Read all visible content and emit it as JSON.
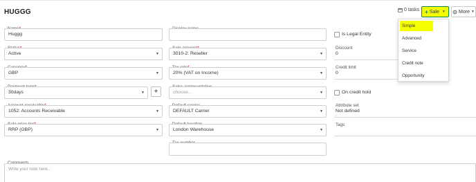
{
  "page": {
    "title": "HUGGG"
  },
  "header": {
    "tasks_label": "0 tasks",
    "sale_button": "Sale",
    "more_button": "More"
  },
  "sale_menu": {
    "items": [
      "Simple",
      "Advanced",
      "Service",
      "Credit note",
      "Opportunity"
    ],
    "highlighted": "Simple"
  },
  "form": {
    "name": {
      "label": "Name",
      "required_mark": "*",
      "value": "Huggg"
    },
    "display_name": {
      "label": "Display name",
      "value": ""
    },
    "is_legal_entity": {
      "label": "Is Legal Entity",
      "checked": false
    },
    "status": {
      "label": "Status",
      "required_mark": "*",
      "value": "Active"
    },
    "sale_account": {
      "label": "Sale account",
      "required_mark": "*",
      "value": "3010-2: Reseller"
    },
    "discount": {
      "label": "Discount",
      "value": "0"
    },
    "currency": {
      "label": "Currency",
      "required_mark": "*",
      "value": "GBP"
    },
    "tax_rule": {
      "label": "Tax rule",
      "required_mark": "*",
      "value": "20% (VAT on Income)"
    },
    "credit_limit": {
      "label": "Credit limit",
      "value": "0"
    },
    "payment_term": {
      "label": "Payment term",
      "required_mark": "*",
      "value": "30days"
    },
    "add_button": "+",
    "sales_representative": {
      "label": "Sales representative",
      "placeholder": "choose..."
    },
    "on_credit_hold": {
      "label": "On credit hold",
      "checked": false
    },
    "account_receivable": {
      "label": "Account receivable",
      "required_mark": "*",
      "value": "1052: Accounts Receivable"
    },
    "default_carrier": {
      "label": "Default carrier",
      "value": "DEFAULT Carrier"
    },
    "attribute_set": {
      "label": "Attribute set",
      "value": "Not defined"
    },
    "sale_price_tier": {
      "label": "Sale price tier",
      "required_mark": "*",
      "value": "RRP (GBP)"
    },
    "default_location": {
      "label": "Default location",
      "value": "London Warehouse"
    },
    "tags": {
      "label": "Tags",
      "value": ""
    },
    "tax_number": {
      "label": "Tax number",
      "value": ""
    },
    "comments": {
      "label": "Comments",
      "placeholder": "Write your note here..."
    }
  },
  "colors": {
    "highlight": "#f6ff00",
    "accent_green": "#0b8a3c",
    "required": "#d0021b"
  }
}
